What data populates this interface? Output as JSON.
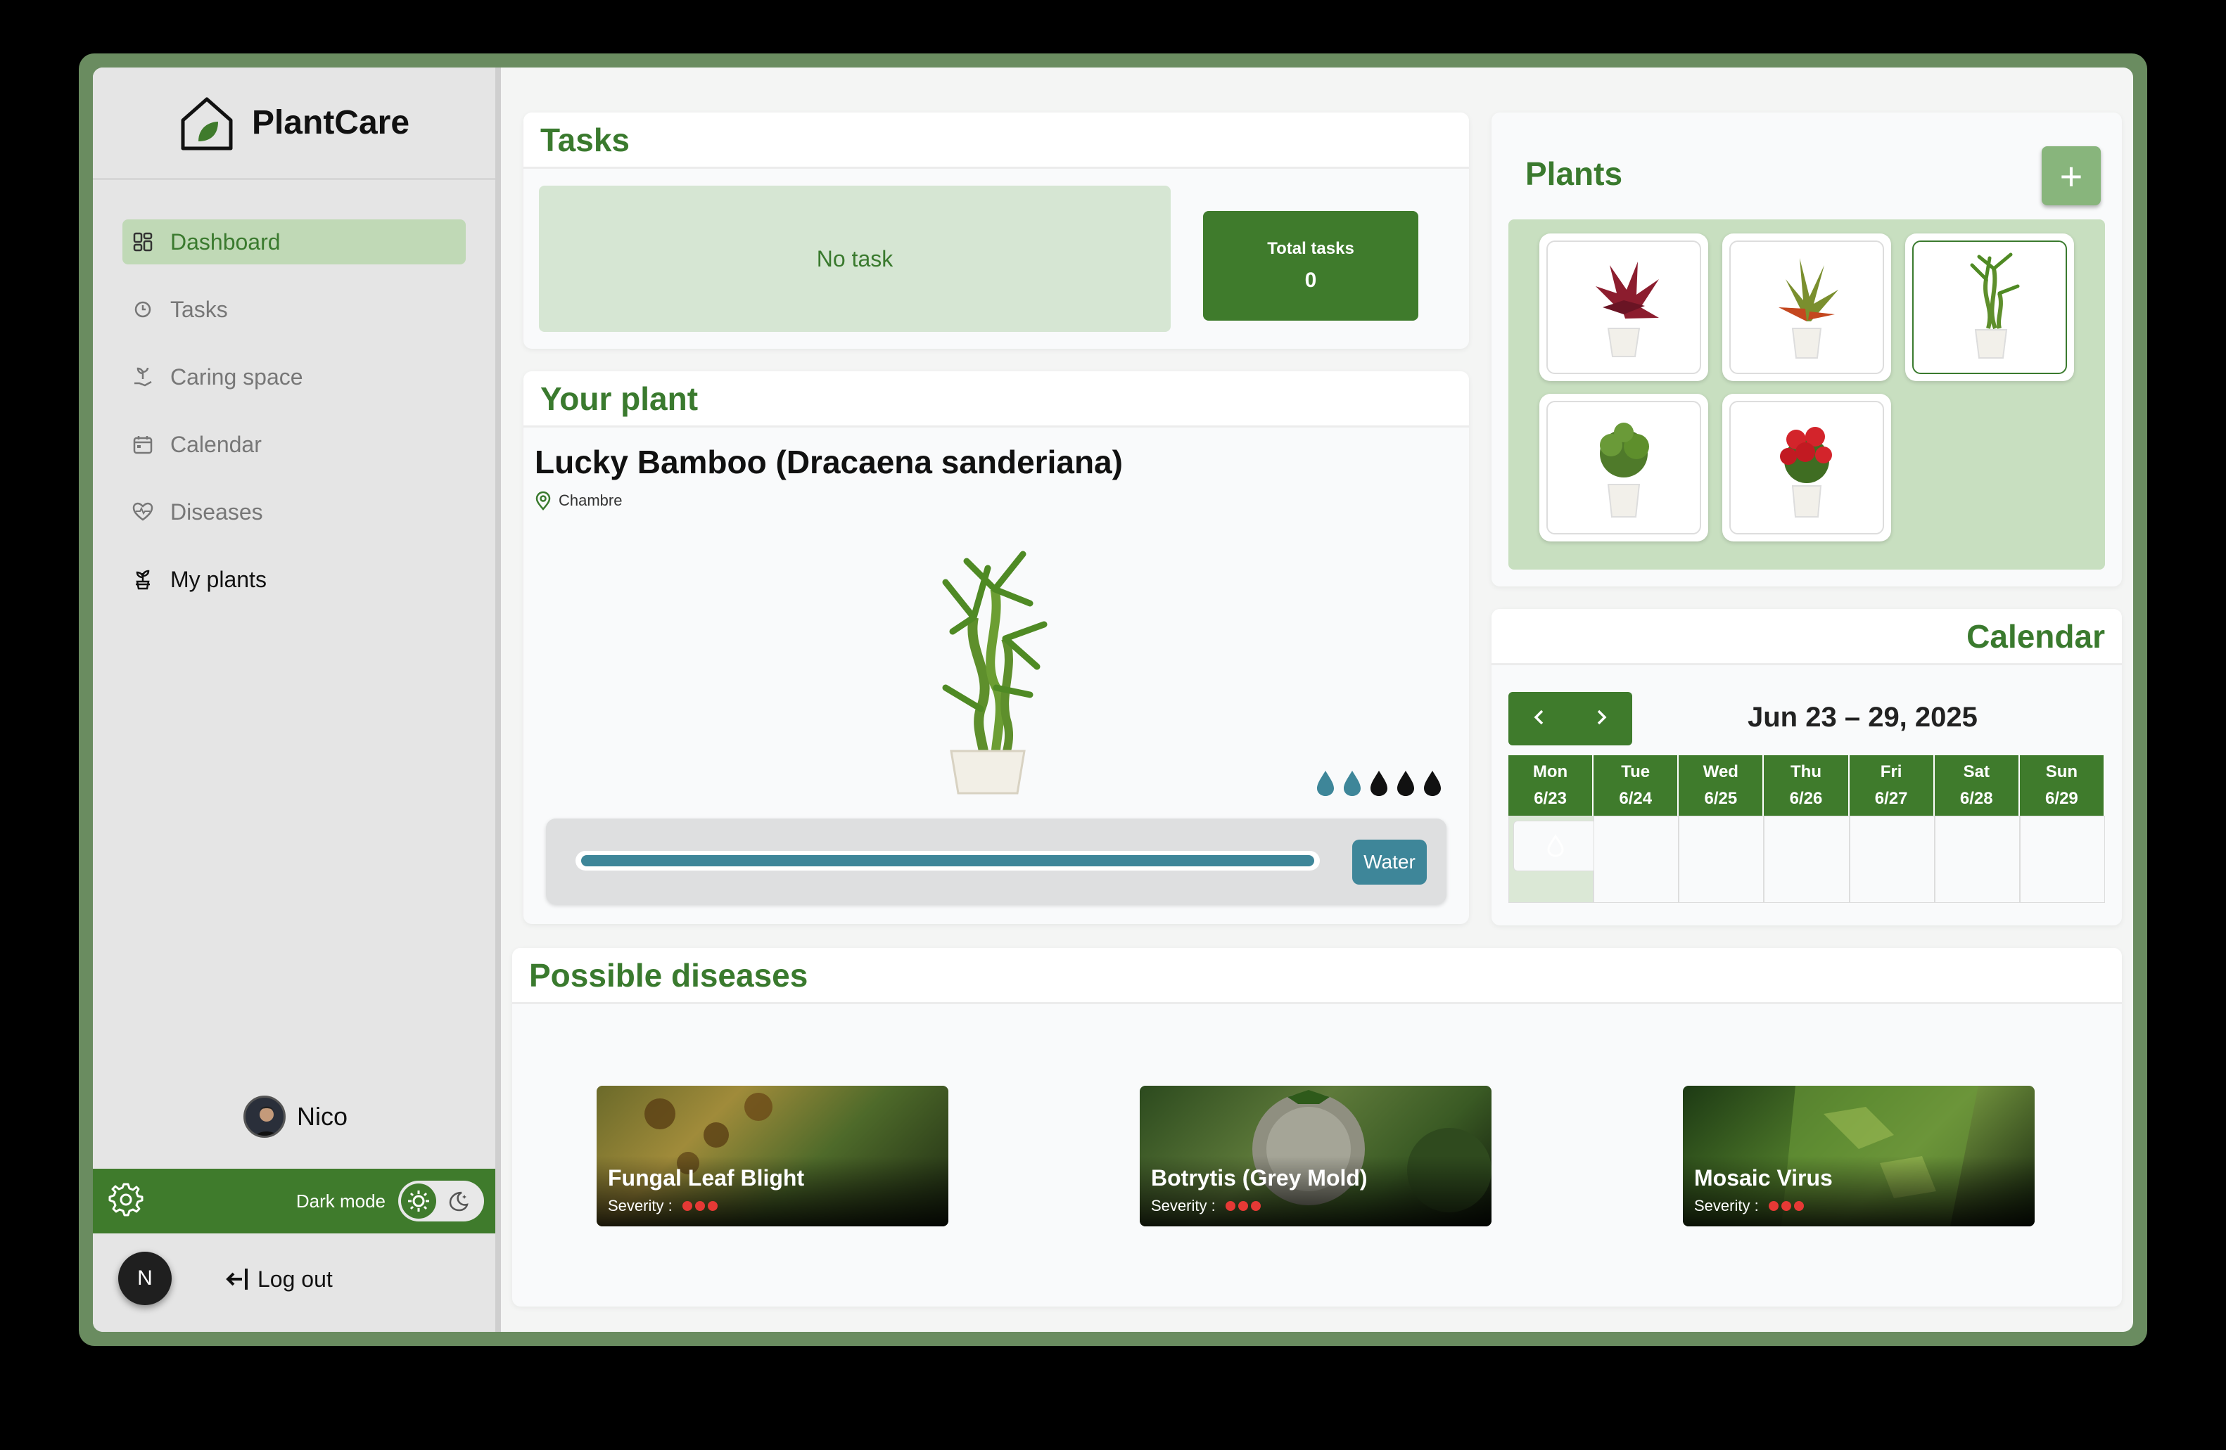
{
  "app": {
    "name": "PlantCare"
  },
  "sidebar": {
    "items": [
      {
        "label": "Dashboard",
        "icon": "dashboard-icon"
      },
      {
        "label": "Tasks",
        "icon": "clock-icon"
      },
      {
        "label": "Caring space",
        "icon": "hand-plant-icon"
      },
      {
        "label": "Calendar",
        "icon": "calendar-icon"
      },
      {
        "label": "Diseases",
        "icon": "heart-pulse-icon"
      },
      {
        "label": "My plants",
        "icon": "potted-plant-icon"
      }
    ],
    "user": {
      "name": "Nico"
    },
    "dark_mode_label": "Dark mode",
    "avatar_letter": "N",
    "logout_label": "Log out"
  },
  "tasks": {
    "title": "Tasks",
    "empty": "No task",
    "total_label": "Total tasks",
    "total_value": "0"
  },
  "your_plant": {
    "title": "Your plant",
    "name": "Lucky Bamboo (Dracaena sanderiana)",
    "location": "Chambre",
    "water_level": {
      "filled": 2,
      "total": 5
    },
    "progress": 1.0,
    "water_button": "Water"
  },
  "plants": {
    "title": "Plants",
    "add_label": "+"
  },
  "calendar": {
    "title": "Calendar",
    "range": "Jun 23 – 29, 2025",
    "days": [
      {
        "day": "Mon",
        "date": "6/23"
      },
      {
        "day": "Tue",
        "date": "6/24"
      },
      {
        "day": "Wed",
        "date": "6/25"
      },
      {
        "day": "Thu",
        "date": "6/26"
      },
      {
        "day": "Fri",
        "date": "6/27"
      },
      {
        "day": "Sat",
        "date": "6/28"
      },
      {
        "day": "Sun",
        "date": "6/29"
      }
    ]
  },
  "diseases": {
    "title": "Possible diseases",
    "severity_label": "Severity :",
    "items": [
      {
        "name": "Fungal Leaf Blight",
        "severity": 3
      },
      {
        "name": "Botrytis (Grey Mold)",
        "severity": 3
      },
      {
        "name": "Mosaic Virus",
        "severity": 3
      }
    ]
  },
  "colors": {
    "accent": "#3f7b2c",
    "water": "#3e8699",
    "danger": "#e53935"
  }
}
